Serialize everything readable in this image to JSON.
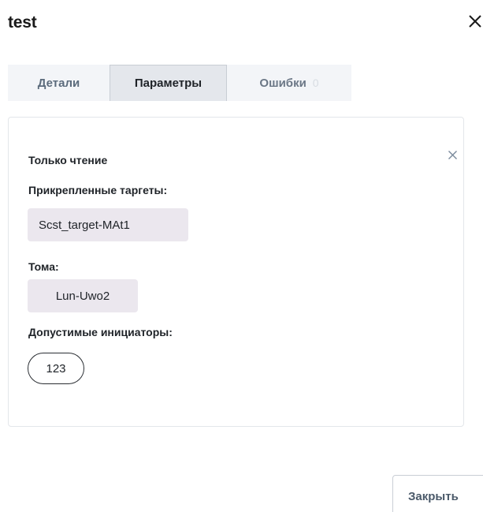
{
  "dialog": {
    "title": "test",
    "close_icon": "close-icon"
  },
  "tabs": [
    {
      "label": "Детали",
      "active": false
    },
    {
      "label": "Параметры",
      "active": true
    },
    {
      "label": "Ошибки",
      "count": "0",
      "active": false
    }
  ],
  "panel": {
    "mode_label": "Только чтение",
    "close_icon": "close-icon",
    "targets_label": "Прикрепленные таргеты:",
    "targets": [
      "Scst_target-MAt1"
    ],
    "volumes_label": "Тома:",
    "volumes": [
      "Lun-Uwo2"
    ],
    "initiators_label": "Допустимые инициаторы:",
    "initiators": [
      "123"
    ]
  },
  "footer": {
    "close_label": "Закрыть"
  },
  "colors": {
    "active_tab_bg": "#e4e7ec",
    "chip_bg": "#ebe7ee",
    "muted_text": "#5b6b7c"
  }
}
